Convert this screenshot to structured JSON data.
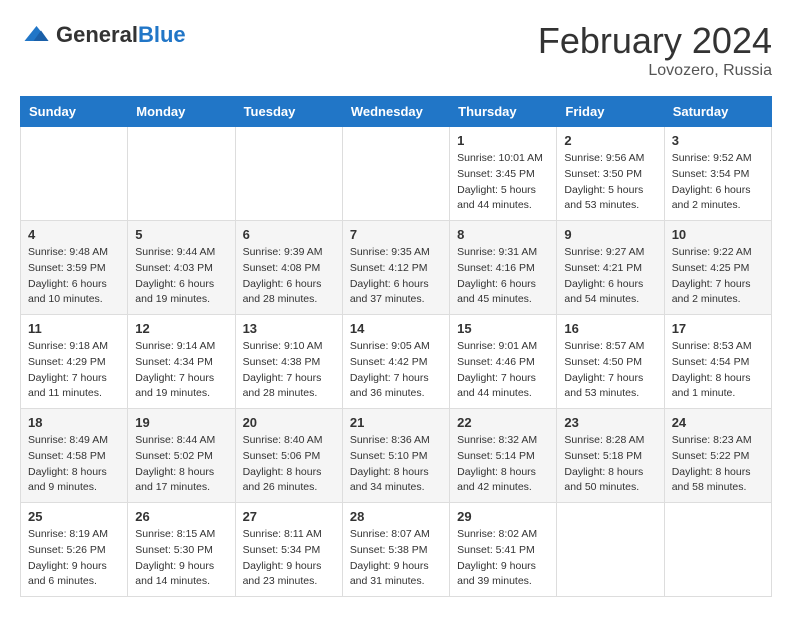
{
  "logo": {
    "general": "General",
    "blue": "Blue"
  },
  "header": {
    "month": "February 2024",
    "location": "Lovozero, Russia"
  },
  "weekdays": [
    "Sunday",
    "Monday",
    "Tuesday",
    "Wednesday",
    "Thursday",
    "Friday",
    "Saturday"
  ],
  "weeks": [
    [
      {
        "day": "",
        "info": ""
      },
      {
        "day": "",
        "info": ""
      },
      {
        "day": "",
        "info": ""
      },
      {
        "day": "",
        "info": ""
      },
      {
        "day": "1",
        "info": "Sunrise: 10:01 AM\nSunset: 3:45 PM\nDaylight: 5 hours and 44 minutes."
      },
      {
        "day": "2",
        "info": "Sunrise: 9:56 AM\nSunset: 3:50 PM\nDaylight: 5 hours and 53 minutes."
      },
      {
        "day": "3",
        "info": "Sunrise: 9:52 AM\nSunset: 3:54 PM\nDaylight: 6 hours and 2 minutes."
      }
    ],
    [
      {
        "day": "4",
        "info": "Sunrise: 9:48 AM\nSunset: 3:59 PM\nDaylight: 6 hours and 10 minutes."
      },
      {
        "day": "5",
        "info": "Sunrise: 9:44 AM\nSunset: 4:03 PM\nDaylight: 6 hours and 19 minutes."
      },
      {
        "day": "6",
        "info": "Sunrise: 9:39 AM\nSunset: 4:08 PM\nDaylight: 6 hours and 28 minutes."
      },
      {
        "day": "7",
        "info": "Sunrise: 9:35 AM\nSunset: 4:12 PM\nDaylight: 6 hours and 37 minutes."
      },
      {
        "day": "8",
        "info": "Sunrise: 9:31 AM\nSunset: 4:16 PM\nDaylight: 6 hours and 45 minutes."
      },
      {
        "day": "9",
        "info": "Sunrise: 9:27 AM\nSunset: 4:21 PM\nDaylight: 6 hours and 54 minutes."
      },
      {
        "day": "10",
        "info": "Sunrise: 9:22 AM\nSunset: 4:25 PM\nDaylight: 7 hours and 2 minutes."
      }
    ],
    [
      {
        "day": "11",
        "info": "Sunrise: 9:18 AM\nSunset: 4:29 PM\nDaylight: 7 hours and 11 minutes."
      },
      {
        "day": "12",
        "info": "Sunrise: 9:14 AM\nSunset: 4:34 PM\nDaylight: 7 hours and 19 minutes."
      },
      {
        "day": "13",
        "info": "Sunrise: 9:10 AM\nSunset: 4:38 PM\nDaylight: 7 hours and 28 minutes."
      },
      {
        "day": "14",
        "info": "Sunrise: 9:05 AM\nSunset: 4:42 PM\nDaylight: 7 hours and 36 minutes."
      },
      {
        "day": "15",
        "info": "Sunrise: 9:01 AM\nSunset: 4:46 PM\nDaylight: 7 hours and 44 minutes."
      },
      {
        "day": "16",
        "info": "Sunrise: 8:57 AM\nSunset: 4:50 PM\nDaylight: 7 hours and 53 minutes."
      },
      {
        "day": "17",
        "info": "Sunrise: 8:53 AM\nSunset: 4:54 PM\nDaylight: 8 hours and 1 minute."
      }
    ],
    [
      {
        "day": "18",
        "info": "Sunrise: 8:49 AM\nSunset: 4:58 PM\nDaylight: 8 hours and 9 minutes."
      },
      {
        "day": "19",
        "info": "Sunrise: 8:44 AM\nSunset: 5:02 PM\nDaylight: 8 hours and 17 minutes."
      },
      {
        "day": "20",
        "info": "Sunrise: 8:40 AM\nSunset: 5:06 PM\nDaylight: 8 hours and 26 minutes."
      },
      {
        "day": "21",
        "info": "Sunrise: 8:36 AM\nSunset: 5:10 PM\nDaylight: 8 hours and 34 minutes."
      },
      {
        "day": "22",
        "info": "Sunrise: 8:32 AM\nSunset: 5:14 PM\nDaylight: 8 hours and 42 minutes."
      },
      {
        "day": "23",
        "info": "Sunrise: 8:28 AM\nSunset: 5:18 PM\nDaylight: 8 hours and 50 minutes."
      },
      {
        "day": "24",
        "info": "Sunrise: 8:23 AM\nSunset: 5:22 PM\nDaylight: 8 hours and 58 minutes."
      }
    ],
    [
      {
        "day": "25",
        "info": "Sunrise: 8:19 AM\nSunset: 5:26 PM\nDaylight: 9 hours and 6 minutes."
      },
      {
        "day": "26",
        "info": "Sunrise: 8:15 AM\nSunset: 5:30 PM\nDaylight: 9 hours and 14 minutes."
      },
      {
        "day": "27",
        "info": "Sunrise: 8:11 AM\nSunset: 5:34 PM\nDaylight: 9 hours and 23 minutes."
      },
      {
        "day": "28",
        "info": "Sunrise: 8:07 AM\nSunset: 5:38 PM\nDaylight: 9 hours and 31 minutes."
      },
      {
        "day": "29",
        "info": "Sunrise: 8:02 AM\nSunset: 5:41 PM\nDaylight: 9 hours and 39 minutes."
      },
      {
        "day": "",
        "info": ""
      },
      {
        "day": "",
        "info": ""
      }
    ]
  ]
}
